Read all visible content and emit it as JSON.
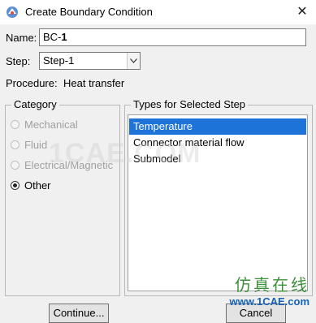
{
  "window": {
    "title": "Create Boundary Condition",
    "close_glyph": "✕"
  },
  "name": {
    "label": "Name:",
    "value_prefix": "BC-",
    "value_suffix": "1"
  },
  "step": {
    "label": "Step:",
    "value": "Step-1"
  },
  "procedure": {
    "label": "Procedure:",
    "value": "Heat transfer"
  },
  "category": {
    "title": "Category",
    "options": [
      {
        "label": "Mechanical",
        "selected": false,
        "enabled": false
      },
      {
        "label": "Fluid",
        "selected": false,
        "enabled": false
      },
      {
        "label": "Electrical/Magnetic",
        "selected": false,
        "enabled": false
      },
      {
        "label": "Other",
        "selected": true,
        "enabled": true
      }
    ]
  },
  "types": {
    "title": "Types for Selected Step",
    "items": [
      "Temperature",
      "Connector material flow",
      "Submodel"
    ],
    "selected_index": 0
  },
  "buttons": {
    "continue_label": "Continue...",
    "cancel_label": "Cancel"
  },
  "watermark": {
    "text": "1CAE.COM"
  },
  "brand": {
    "cn": "仿真在线",
    "url": "www.1CAE.com"
  },
  "colors": {
    "selection": "#1e73d8",
    "brand_green": "#3d8f3a",
    "brand_blue": "#1763b5"
  }
}
